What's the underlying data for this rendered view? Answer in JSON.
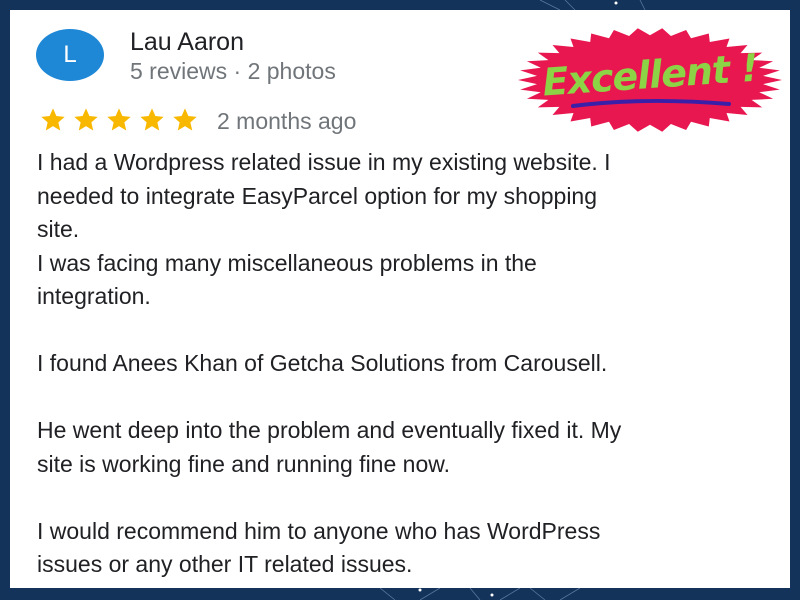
{
  "reviewer": {
    "avatar_initial": "L",
    "name": "Lau Aaron",
    "meta": "5 reviews · 2 photos"
  },
  "rating": {
    "stars": 5,
    "max_stars": 5,
    "star_icon": "star-icon",
    "date": "2 months ago"
  },
  "badge": {
    "text": "Excellent !"
  },
  "review": {
    "paragraphs": [
      {
        "lines": [
          "I had a Wordpress related issue in my existing website. I",
          "needed to integrate EasyParcel option for my shopping",
          "site.",
          "I was facing many miscellaneous problems in the",
          "integration."
        ]
      },
      {
        "lines": [
          "I found Anees Khan of Getcha Solutions from Carousell."
        ]
      },
      {
        "lines": [
          "He went deep into the problem and eventually fixed it. My",
          "site is working fine and running fine now."
        ]
      },
      {
        "lines": [
          "I would recommend him to anyone who has WordPress",
          "issues or any other IT related issues."
        ]
      }
    ]
  },
  "colors": {
    "background": "#14335a",
    "card": "#ffffff",
    "avatar": "#1e88d6",
    "star": "#f9b800",
    "badge_burst": "#e8174f",
    "badge_text": "#8cd446",
    "badge_underline": "#3a1fa8",
    "name_text": "#202124",
    "meta_text": "#70757a"
  }
}
